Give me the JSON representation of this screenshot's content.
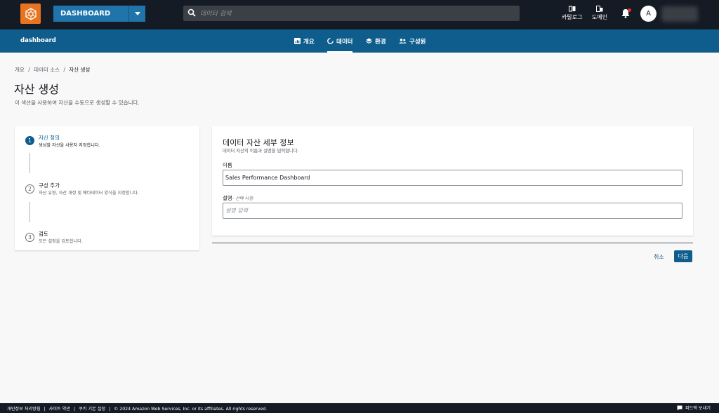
{
  "topbar": {
    "project_name": "DASHBOARD",
    "search_placeholder": "데이터 검색",
    "catalog_label": "카탈로그",
    "domain_label": "도메인",
    "avatar_initial": "A"
  },
  "nav": {
    "title": "dashboard",
    "tabs": [
      {
        "label": "개요",
        "icon": "overview-icon"
      },
      {
        "label": "데이터",
        "icon": "data-icon",
        "active": true
      },
      {
        "label": "환경",
        "icon": "layers-icon"
      },
      {
        "label": "구성원",
        "icon": "members-icon"
      }
    ]
  },
  "breadcrumb": {
    "items": [
      "개요",
      "데이터 소스",
      "자산 생성"
    ],
    "separator": "/"
  },
  "page": {
    "title": "자산 생성",
    "description": "이 섹션을 사용하여 자산을 수동으로 생성할 수 있습니다."
  },
  "steps": [
    {
      "number": "1",
      "title": "자산 정의",
      "subtitle": "생성할 자산을 사용자 지정합니다."
    },
    {
      "number": "2",
      "title": "구성 추가",
      "subtitle": "자산 유형, 자산 개정 및 메타데이터 양식을 지정합니다."
    },
    {
      "number": "3",
      "title": "검토",
      "subtitle": "모든 설정을 검토합니다."
    }
  ],
  "panel": {
    "title": "데이터 자산 세부 정보",
    "description": "데이터 자산의 이름과 설명을 입력합니다.",
    "name_label": "이름",
    "name_value": "Sales Performance Dashboard",
    "desc_label": "설명",
    "desc_optional": "- 선택 사항",
    "desc_placeholder": "설명 입력"
  },
  "actions": {
    "cancel": "취소",
    "next": "다음"
  },
  "footer": {
    "privacy": "개인정보 처리방침",
    "terms": "사이트 약관",
    "cookies": "쿠키 기본 설정",
    "copyright": "© 2024 Amazon Web Services, Inc. or its affiliates. All rights reserved.",
    "sep": "|",
    "feedback": "피드백 보내기"
  },
  "colors": {
    "topbar": "#151b24",
    "nav": "#0f5d8d",
    "accent": "#1f74ac",
    "logo": "#e8741f"
  }
}
